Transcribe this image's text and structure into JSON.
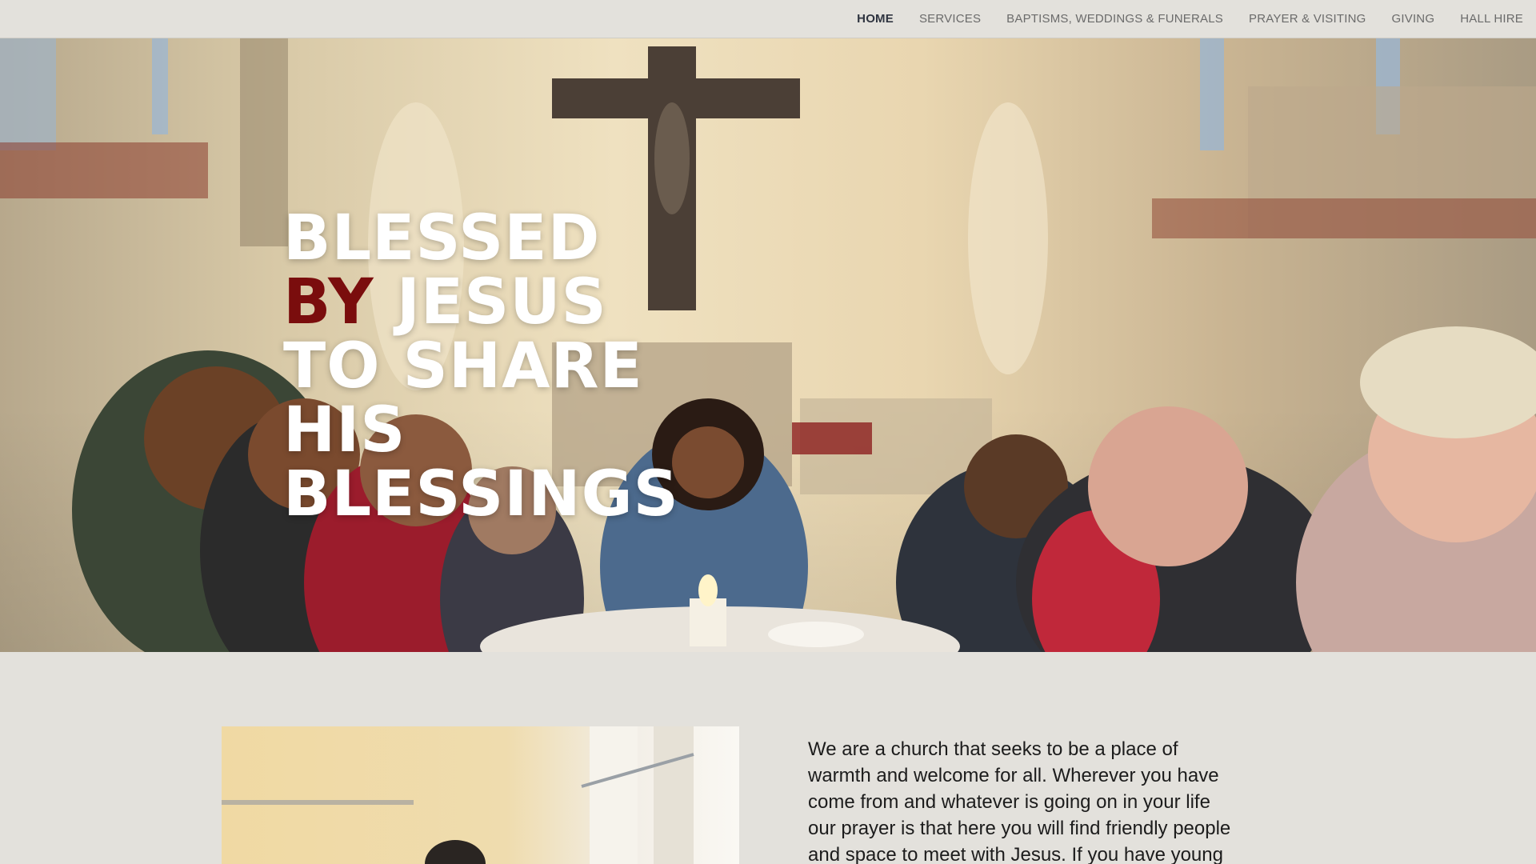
{
  "nav": {
    "items": [
      {
        "label": "HOME",
        "active": true
      },
      {
        "label": "SERVICES"
      },
      {
        "label": "BAPTISMS, WEDDINGS & FUNERALS"
      },
      {
        "label": "PRAYER & VISITING"
      },
      {
        "label": "GIVING"
      },
      {
        "label": "HALL HIRE"
      }
    ]
  },
  "hero": {
    "title_part1": "Blessed",
    "title_accent": "by",
    "title_part2": "Jesus to share his blessings",
    "accent_color": "#7a0d0d"
  },
  "intro": {
    "text": "We are a church that seeks to be a place of warmth and welcome for all.  Wherever you have come from and whatever is going on in your life our prayer is that here you will find friendly people and space to meet with Jesus. If you have young"
  }
}
